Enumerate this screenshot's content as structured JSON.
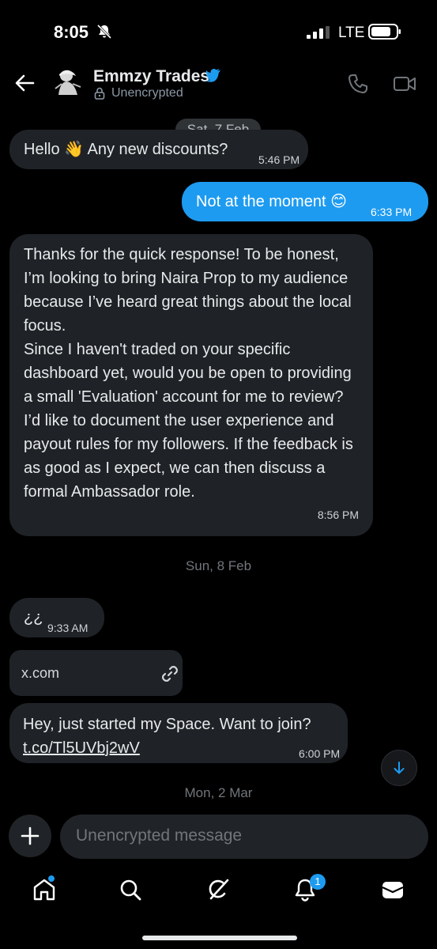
{
  "status_bar": {
    "time": "8:05",
    "network": "LTE"
  },
  "header": {
    "contact_name": "Emmzy Trades",
    "encryption_label": "Unencrypted",
    "icons": [
      "back-arrow-icon",
      "avatar",
      "verified-badge-icon",
      "lock-icon",
      "phone-icon",
      "video-icon"
    ]
  },
  "dates": [
    "Sat, 7 Feb",
    "Sun, 8 Feb",
    "Mon, 2 Mar"
  ],
  "messages": [
    {
      "direction": "received",
      "text": "Hello 👋 Any new discounts?",
      "time": "5:46 PM"
    },
    {
      "direction": "sent",
      "text": "Not at the moment 😊",
      "time": "6:33 PM"
    },
    {
      "direction": "received",
      "text": "Thanks for the quick response! To be honest, I’m looking to bring Naira Prop to my audience because I’ve heard great things about the local focus.\nSince I haven't traded on your specific dashboard yet, would you be open to providing a small 'Evaluation' account for me to review? I’d like to document the user experience and payout rules for my followers. If the feedback is as good as I expect, we can then discuss a formal Ambassador role.",
      "time": "8:56 PM"
    },
    {
      "direction": "received",
      "text": "¿¿",
      "time": "9:33 AM"
    },
    {
      "direction": "received",
      "text": "Hey, just started my Space. Want to join?",
      "link": "t.co/Tl5UVbj2wV",
      "time": "6:00 PM"
    }
  ],
  "link_card": {
    "domain": "x.com"
  },
  "composer": {
    "placeholder": "Unencrypted message"
  },
  "tab_bar": {
    "items": [
      "home-icon",
      "search-icon",
      "grok-icon",
      "notifications-icon",
      "messages-icon"
    ],
    "notifications_badge": "1"
  },
  "colors": {
    "accent": "#1d9bf0",
    "background": "#000000",
    "bubble_received": "#1f2327"
  }
}
